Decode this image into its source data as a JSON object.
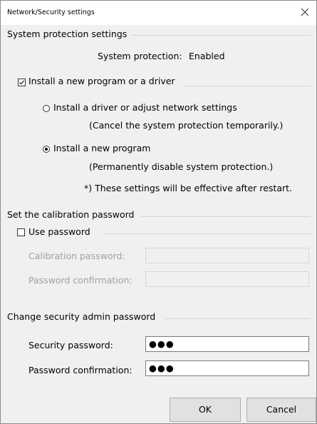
{
  "window": {
    "title": "Network/Security settings"
  },
  "system_protection": {
    "group_title": "System protection settings",
    "status_label": "System protection:",
    "status_value": "Enabled",
    "install_checkbox_label": "Install a new program or a driver",
    "install_checkbox_checked": true,
    "option_driver_label": "Install a driver or adjust network settings",
    "option_driver_note": "(Cancel the system protection temporarily.)",
    "option_driver_selected": false,
    "option_program_label": "Install a new program",
    "option_program_note": "(Permanently disable system protection.)",
    "option_program_selected": true,
    "restart_note": "*) These settings will be effective after restart."
  },
  "calibration": {
    "group_title": "Set the calibration password",
    "use_password_label": "Use password",
    "use_password_checked": false,
    "password_label": "Calibration password:",
    "password_value": "",
    "confirm_label": "Password confirmation:",
    "confirm_value": ""
  },
  "security_admin": {
    "group_title": "Change security admin password",
    "password_label": "Security password:",
    "password_value": "●●●",
    "confirm_label": "Password confirmation:",
    "confirm_value": "●●●"
  },
  "buttons": {
    "ok": "OK",
    "cancel": "Cancel"
  }
}
